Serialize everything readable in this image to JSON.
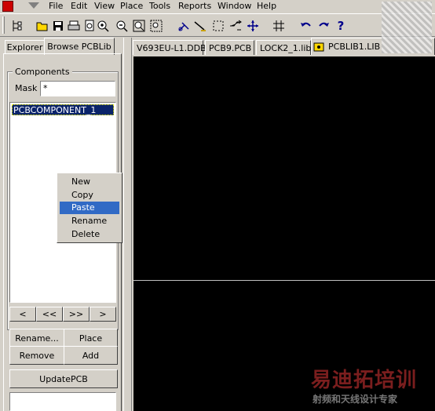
{
  "menu": [
    "File",
    "Edit",
    "View",
    "Place",
    "Tools",
    "Reports",
    "Window",
    "Help"
  ],
  "toolbar_icons": [
    "tree-icon",
    "open-folder-icon",
    "save-icon",
    "print-icon",
    "print-preview-icon",
    "zoom-in-icon",
    "zoom-out-icon",
    "zoom-fit-icon",
    "zoom-area-icon",
    "cut-wire-icon",
    "line-icon",
    "select-rect-icon",
    "route-icon",
    "move-icon",
    "grid-icon",
    "undo-icon",
    "redo-icon",
    "help-icon"
  ],
  "panel": {
    "tabs": [
      "Explorer",
      "Browse PCBLib"
    ],
    "group_label": "Components",
    "mask_label": "Mask",
    "mask_value": "*",
    "list_items": [
      "PCBCOMPONENT_1"
    ],
    "nav_buttons": [
      "<",
      "<<",
      ">>",
      ">"
    ],
    "buttons": {
      "rename": "Rename...",
      "place": "Place",
      "remove": "Remove",
      "add": "Add",
      "update": "UpdatePCB"
    }
  },
  "context_menu": {
    "items": [
      "New",
      "Copy",
      "Paste",
      "Rename",
      "Delete"
    ],
    "selected": "Paste"
  },
  "doc_tabs": [
    "V693EU-L1.DDB",
    "PCB9.PCB",
    "LOCK2_1.lib",
    "PCBLIB1.LIB"
  ],
  "active_doc_tab": "PCBLIB1.LIB",
  "colors": {
    "canvas": "#000000",
    "selection": "#0a246a",
    "accent": "#316ac5"
  }
}
